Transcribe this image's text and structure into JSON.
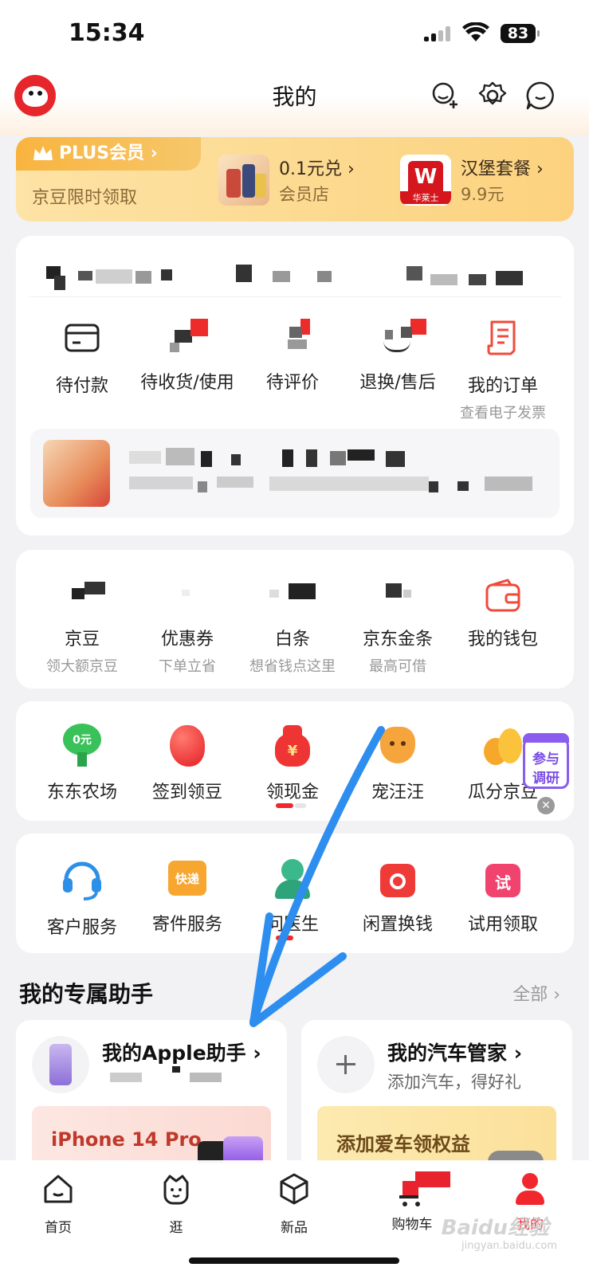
{
  "status": {
    "time": "15:34",
    "battery": "83"
  },
  "nav": {
    "title": "我的"
  },
  "plus": {
    "tag": "PLUS会员",
    "subtitle": "京豆限时领取",
    "items": [
      {
        "title": "0.1元兑 ›",
        "sub": "会员店"
      },
      {
        "title": "汉堡套餐 ›",
        "sub": "9.9元",
        "brand": "华莱士"
      }
    ]
  },
  "orders": {
    "items": [
      {
        "label": "待付款"
      },
      {
        "label": "待收货/使用"
      },
      {
        "label": "待评价"
      },
      {
        "label": "退换/售后"
      },
      {
        "label": "我的订单",
        "sub": "查看电子发票"
      }
    ]
  },
  "wallet": {
    "items": [
      {
        "label": "京豆",
        "sub": "领大额京豆"
      },
      {
        "label": "优惠券",
        "sub": "下单立省"
      },
      {
        "label": "白条",
        "sub": "想省钱点这里"
      },
      {
        "label": "京东金条",
        "sub": "最高可借"
      },
      {
        "label": "我的钱包",
        "sub": ""
      }
    ]
  },
  "activities": {
    "items": [
      {
        "label": "东东农场",
        "badge": "0元"
      },
      {
        "label": "签到领豆"
      },
      {
        "label": "领现金"
      },
      {
        "label": "宠汪汪"
      },
      {
        "label": "瓜分京豆"
      }
    ]
  },
  "services": {
    "items": [
      {
        "label": "客户服务"
      },
      {
        "label": "寄件服务",
        "badge": "快递"
      },
      {
        "label": "问医生"
      },
      {
        "label": "闲置换钱"
      },
      {
        "label": "试用领取",
        "badge": "试"
      }
    ]
  },
  "survey": {
    "line1": "参与",
    "line2": "调研"
  },
  "assistant": {
    "title": "我的专属助手",
    "more": "全部 ›",
    "cards": [
      {
        "title": "我的Apple助手 ›",
        "sub": "",
        "banner": "iPhone 14 Pro"
      },
      {
        "title": "我的汽车管家 ›",
        "sub": "添加汽车，得好礼",
        "banner": "添加爱车领权益"
      }
    ]
  },
  "tabs": [
    {
      "label": "首页"
    },
    {
      "label": "逛"
    },
    {
      "label": "新品"
    },
    {
      "label": "购物车"
    },
    {
      "label": "我的",
      "active": true
    }
  ],
  "colors": {
    "brand": "#f2272d",
    "gold": "#fcd27e"
  },
  "watermark": {
    "logo": "Baidu经验",
    "url": "jingyan.baidu.com"
  }
}
